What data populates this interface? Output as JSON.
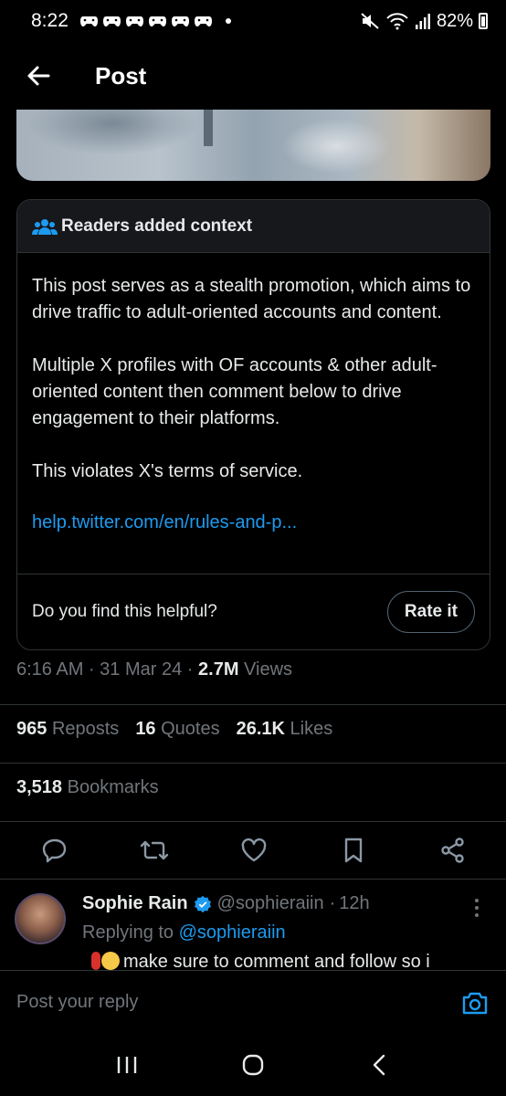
{
  "status_bar": {
    "time": "8:22",
    "battery": "82%"
  },
  "header": {
    "title": "Post",
    "back_icon": "arrow-left-icon"
  },
  "context_note": {
    "heading": "Readers added context",
    "paragraphs": [
      "This post serves as a stealth promotion, which aims to drive traffic to adult-oriented accounts and content.",
      "Multiple X profiles with OF accounts & other adult-oriented content then comment below to drive engagement to their platforms.",
      "This violates X's terms of service."
    ],
    "link": "help.twitter.com/en/rules-and-p...",
    "helpful_prompt": "Do you find this helpful?",
    "rate_label": "Rate it"
  },
  "meta": {
    "time": "6:16 AM",
    "date": "31 Mar 24",
    "views_count": "2.7M",
    "views_label": "Views"
  },
  "stats": {
    "reposts_count": "965",
    "reposts_label": "Reposts",
    "quotes_count": "16",
    "quotes_label": "Quotes",
    "likes_count": "26.1K",
    "likes_label": "Likes",
    "bookmarks_count": "3,518",
    "bookmarks_label": "Bookmarks"
  },
  "actions": [
    "reply-icon",
    "repost-icon",
    "like-icon",
    "bookmark-icon",
    "share-icon"
  ],
  "reply": {
    "name": "Sophie Rain",
    "handle": "@sophieraiin",
    "age": "12h",
    "replying_prefix": "Replying to",
    "replying_to": "@sophieraiin",
    "text": "make sure to comment and follow so i"
  },
  "compose": {
    "placeholder": "Post your reply"
  },
  "colors": {
    "background": "#000000",
    "accent": "#1d9bf0",
    "muted": "#71767b",
    "border": "#2f3336"
  }
}
